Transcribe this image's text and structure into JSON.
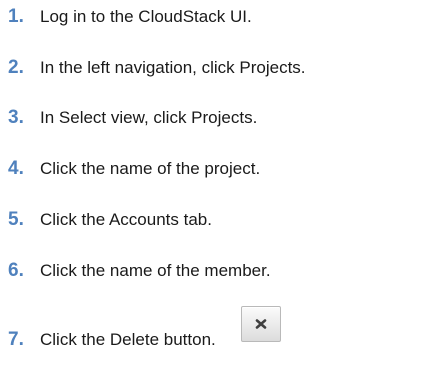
{
  "steps": [
    {
      "number": "1.",
      "text": "Log in to the CloudStack UI."
    },
    {
      "number": "2.",
      "text": "In the left navigation, click Projects."
    },
    {
      "number": "3.",
      "text": "In Select view, click Projects."
    },
    {
      "number": "4.",
      "text": "Click the name of the project."
    },
    {
      "number": "5.",
      "text": "Click the Accounts tab."
    },
    {
      "number": "6.",
      "text": "Click the name of the member."
    },
    {
      "number": "7.",
      "text": "Click the Delete button."
    }
  ],
  "delete_button": {
    "icon": "close-icon"
  },
  "colors": {
    "step_number": "#4f81bd",
    "body_text": "#1a1a1a"
  }
}
